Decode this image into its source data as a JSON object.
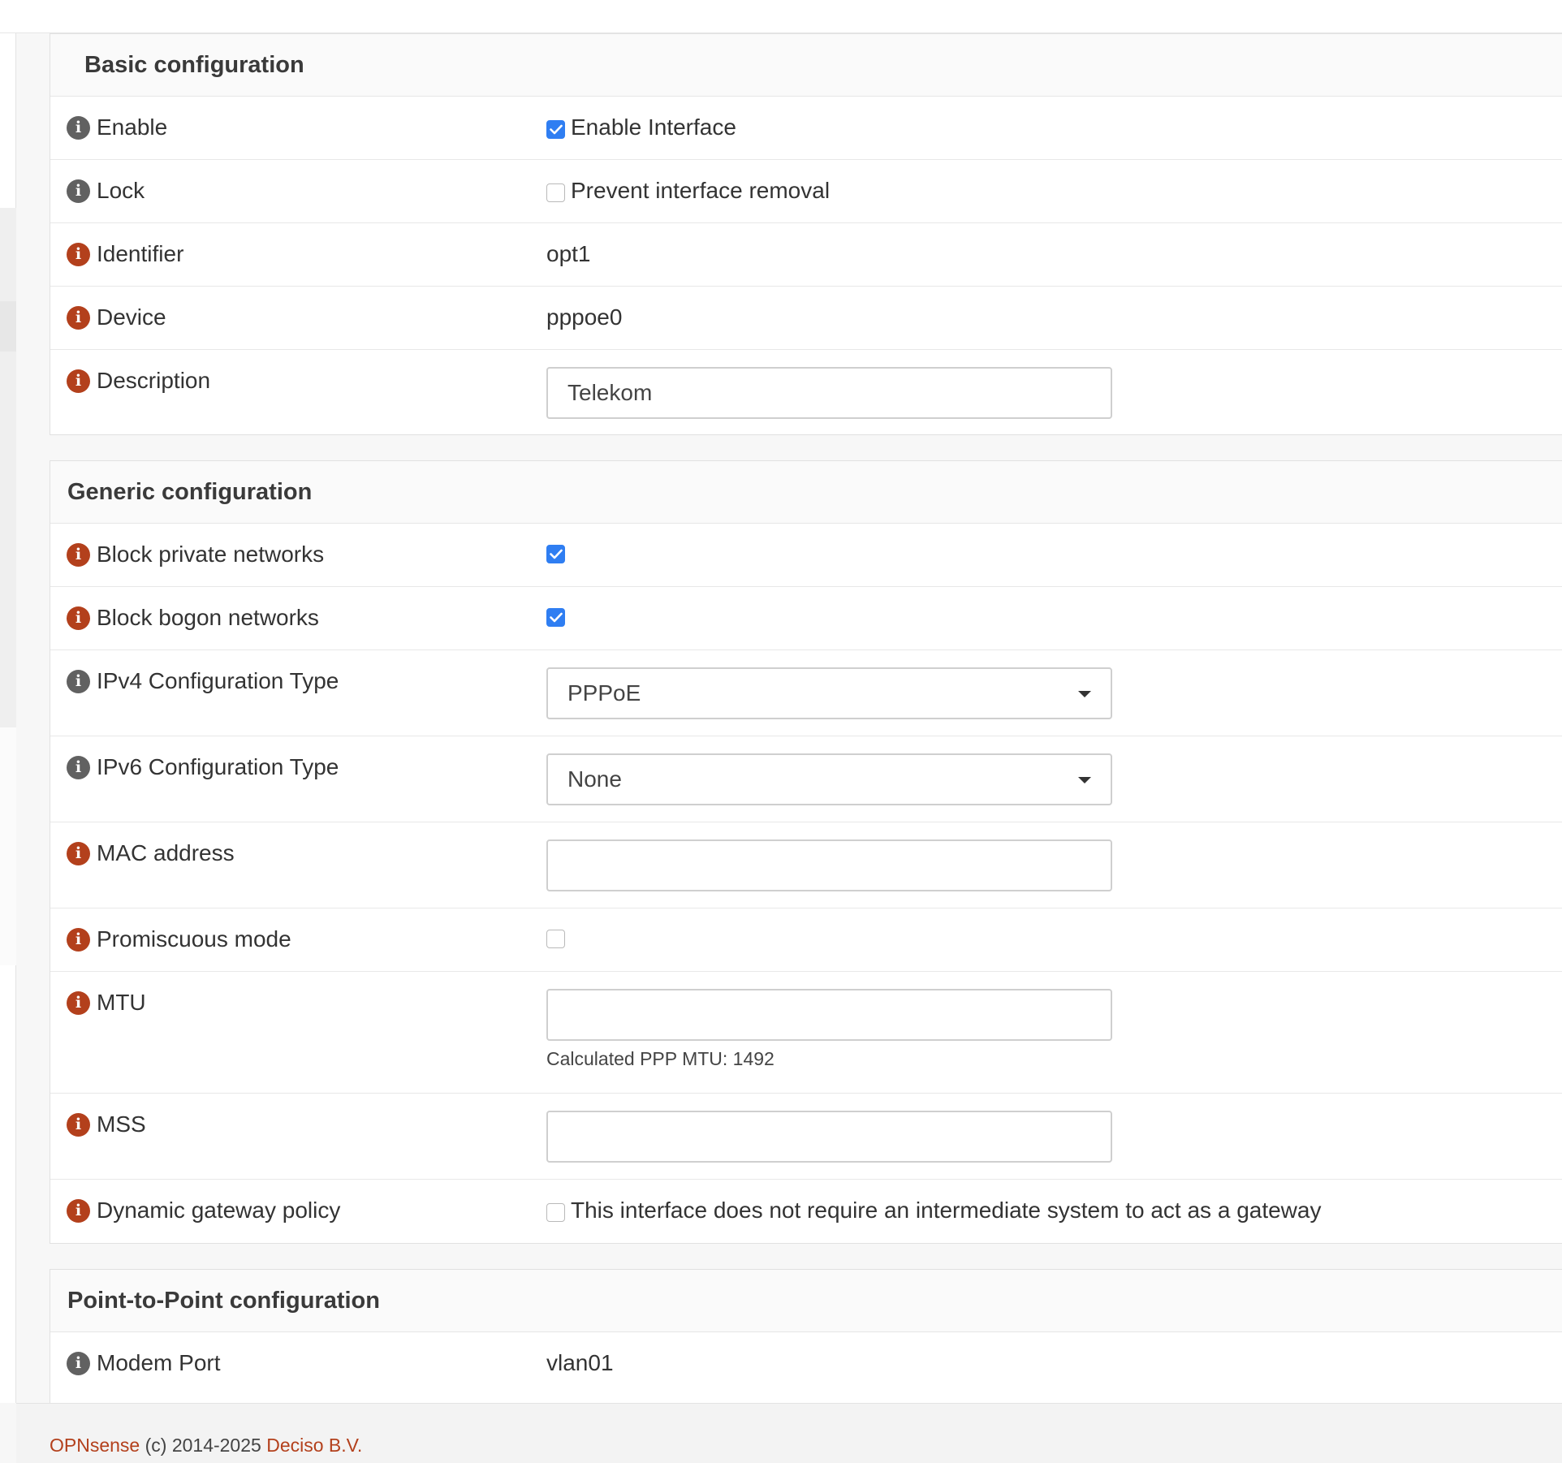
{
  "sections": {
    "basic": {
      "title": "Basic configuration",
      "enable": {
        "label": "Enable",
        "checkbox_label": "Enable Interface",
        "checked": true
      },
      "lock": {
        "label": "Lock",
        "checkbox_label": "Prevent interface removal",
        "checked": false
      },
      "identifier": {
        "label": "Identifier",
        "value": "opt1"
      },
      "device": {
        "label": "Device",
        "value": "pppoe0"
      },
      "description": {
        "label": "Description",
        "value": "Telekom"
      }
    },
    "generic": {
      "title": "Generic configuration",
      "block_private": {
        "label": "Block private networks",
        "checked": true
      },
      "block_bogon": {
        "label": "Block bogon networks",
        "checked": true
      },
      "ipv4_type": {
        "label": "IPv4 Configuration Type",
        "value": "PPPoE"
      },
      "ipv6_type": {
        "label": "IPv6 Configuration Type",
        "value": "None"
      },
      "mac": {
        "label": "MAC address",
        "value": ""
      },
      "promisc": {
        "label": "Promiscuous mode",
        "checked": false
      },
      "mtu": {
        "label": "MTU",
        "value": "",
        "hint": "Calculated PPP MTU: 1492"
      },
      "mss": {
        "label": "MSS",
        "value": ""
      },
      "dyn_gw": {
        "label": "Dynamic gateway policy",
        "checkbox_label": "This interface does not require an intermediate system to act as a gateway",
        "checked": false
      }
    },
    "ptp": {
      "title": "Point-to-Point configuration",
      "modem_port": {
        "label": "Modem Port",
        "value": "vlan01"
      }
    }
  },
  "footer": {
    "brand": "OPNsense",
    "copyright": "(c) 2014-2025",
    "company": "Deciso B.V."
  },
  "colors": {
    "accent": "#b3401c",
    "checkbox_checked": "#2f7ef2",
    "info_neutral": "#616161",
    "info_warning": "#b3401c"
  },
  "icons": {
    "info": "info-icon",
    "checkmark": "check-icon",
    "dropdown": "caret-down-icon"
  }
}
